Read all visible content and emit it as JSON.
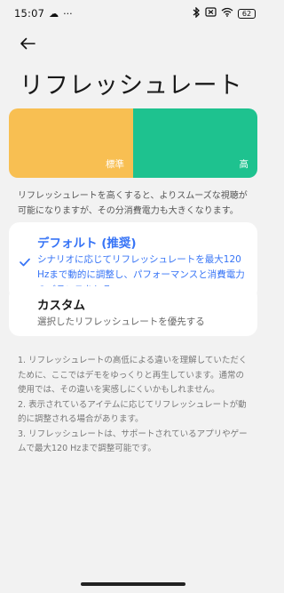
{
  "status_bar": {
    "time": "15:07",
    "cloud_icon": "☁",
    "more_icon": "···",
    "battery": "62"
  },
  "header": {
    "back_icon": "arrow-left",
    "title": "リフレッシュレート"
  },
  "demo": {
    "standard_label": "標準",
    "high_label": "高",
    "standard_color": "#f8bf52",
    "high_color": "#1ec28f"
  },
  "description": "リフレッシュレートを高くすると、よりスムーズな視聴が可能になりますが、その分消費電力も大きくなります。",
  "options": {
    "default": {
      "title": "デフォルト (推奨)",
      "subtitle": "シナリオに応じてリフレッシュレートを最大120 Hzまで動的に調整し、パフォーマンスと消費電力のバランスをとる",
      "selected": true
    },
    "custom": {
      "title": "カスタム",
      "subtitle": "選択したリフレッシュレートを優先する",
      "selected": false
    }
  },
  "notes": [
    "1. リフレッシュレートの高低による違いを理解していただくために、ここではデモをゆっくりと再生しています。通常の使用では、その違いを実感しにくいかもしれません。",
    "2. 表示されているアイテムに応じてリフレッシュレートが動的に調整される場合があります。",
    "3. リフレッシュレートは、サポートされているアプリやゲームで最大120 Hzまで調整可能です。"
  ],
  "accent_color": "#3774f6"
}
